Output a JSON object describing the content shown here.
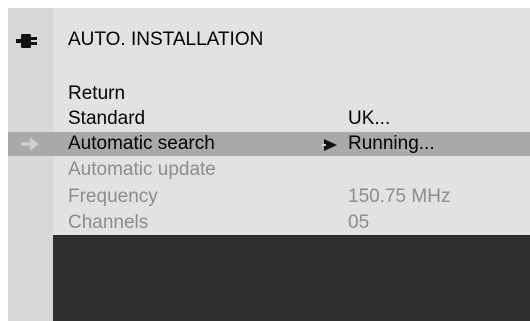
{
  "menu": {
    "title": "AUTO. INSTALLATION",
    "icon": "installation-connector-icon",
    "items": [
      {
        "label": "Return",
        "value": ""
      },
      {
        "label": "Standard",
        "value": "UK..."
      },
      {
        "label": "Automatic search",
        "value": "Running...",
        "selected": true
      },
      {
        "label": "Automatic update",
        "value": ""
      },
      {
        "label": "Frequency",
        "value": "150.75 MHz"
      },
      {
        "label": "Channels",
        "value": "05"
      }
    ]
  },
  "colors": {
    "background": "#e2e2e2",
    "left_strip": "#d7d7d7",
    "highlight": "#a9a9a9",
    "enabled_text": "#000000",
    "disabled_text": "#8c8c8c",
    "bottom_panel": "#2f2f2f"
  }
}
